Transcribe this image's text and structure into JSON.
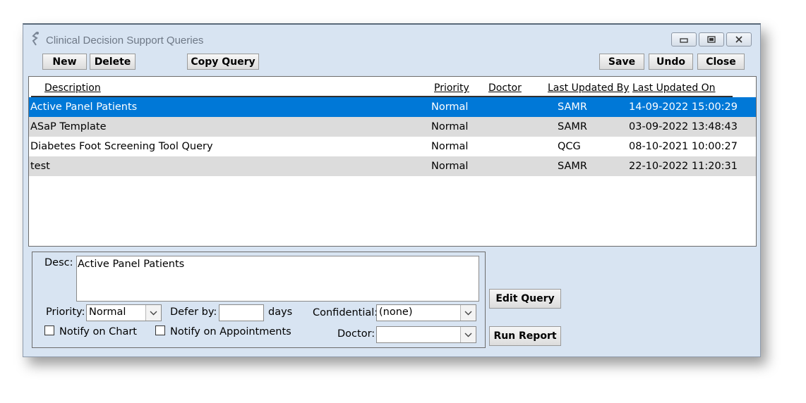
{
  "window": {
    "title": "Clinical Decision Support Queries"
  },
  "toolbar": {
    "new_label": "New",
    "delete_label": "Delete",
    "copy_query_label": "Copy Query",
    "save_label": "Save",
    "undo_label": "Undo",
    "close_label": "Close"
  },
  "table": {
    "columns": [
      "Description",
      "Priority",
      "Doctor",
      "Last Updated By",
      "Last Updated On"
    ],
    "rows": [
      {
        "description": "Active Panel Patients",
        "priority": "Normal",
        "doctor": "",
        "last_updated_by": "SAMR",
        "last_updated_on": "14-09-2022 15:00:29",
        "selected": true
      },
      {
        "description": "ASaP Template",
        "priority": "Normal",
        "doctor": "",
        "last_updated_by": "SAMR",
        "last_updated_on": "03-09-2022 13:48:43",
        "selected": false
      },
      {
        "description": "Diabetes Foot Screening Tool Query",
        "priority": "Normal",
        "doctor": "",
        "last_updated_by": "QCG",
        "last_updated_on": "08-10-2021 10:00:27",
        "selected": false
      },
      {
        "description": "test",
        "priority": "Normal",
        "doctor": "",
        "last_updated_by": "SAMR",
        "last_updated_on": "22-10-2022 11:20:31",
        "selected": false
      }
    ]
  },
  "details": {
    "desc_label": "Desc:",
    "desc_value": "Active Panel Patients",
    "priority_label": "Priority:",
    "priority_value": "Normal",
    "defer_label": "Defer by:",
    "defer_value": "",
    "days_label": "days",
    "confidential_label": "Confidential:",
    "confidential_value": "(none)",
    "doctor_label": "Doctor:",
    "doctor_value": "",
    "notify_chart_label": "Notify on Chart",
    "notify_chart_checked": false,
    "notify_appointments_label": "Notify on Appointments",
    "notify_appointments_checked": false
  },
  "actions": {
    "edit_query_label": "Edit Query",
    "run_report_label": "Run Report"
  },
  "colors": {
    "window_background": "#d8e4f2",
    "selection": "#0078d7",
    "alternate_row": "#dcdcdc"
  },
  "icons": {
    "app": "caduceus-icon",
    "minimize": "minimize-icon",
    "maximize": "maximize-icon",
    "close": "close-icon",
    "dropdown": "chevron-down-icon"
  }
}
